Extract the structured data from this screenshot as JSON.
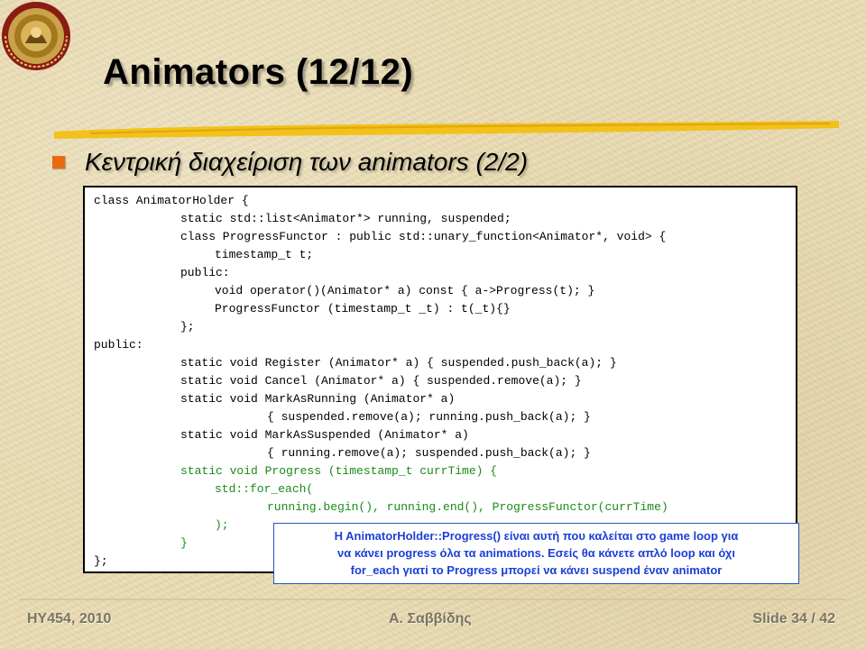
{
  "slide": {
    "title": "Animators (12/12)",
    "subtitle": "Κεντρική διαχείριση των animators (2/2)",
    "logo_text": "UNIVERSITY OF CRETE"
  },
  "code": {
    "lines": [
      {
        "text": "class AnimatorHolder {",
        "indent": 0,
        "color": "black"
      },
      {
        "text": "static std::list<Animator*> running, suspended;",
        "indent": 1,
        "color": "black"
      },
      {
        "text": "class ProgressFunctor : public std::unary_function<Animator*, void> {",
        "indent": 1,
        "color": "black"
      },
      {
        "text": "timestamp_t t;",
        "indent": 2,
        "color": "black"
      },
      {
        "text": "public:",
        "indent": 1,
        "color": "black"
      },
      {
        "text": "void operator()(Animator* a) const { a->Progress(t); }",
        "indent": 2,
        "color": "black"
      },
      {
        "text": "ProgressFunctor (timestamp_t _t) : t(_t){}",
        "indent": 2,
        "color": "black"
      },
      {
        "text": "};",
        "indent": 1,
        "color": "black"
      },
      {
        "text": "public:",
        "indent": 0,
        "color": "black"
      },
      {
        "text": "static void Register (Animator* a) { suspended.push_back(a); }",
        "indent": 1,
        "color": "black"
      },
      {
        "text": "static void Cancel (Animator* a) { suspended.remove(a); }",
        "indent": 1,
        "color": "black"
      },
      {
        "text": "static void MarkAsRunning (Animator* a)",
        "indent": 1,
        "color": "black"
      },
      {
        "text": "{ suspended.remove(a); running.push_back(a); }",
        "indent": 3,
        "color": "black"
      },
      {
        "text": "static void MarkAsSuspended (Animator* a)",
        "indent": 1,
        "color": "black"
      },
      {
        "text": "{ running.remove(a); suspended.push_back(a); }",
        "indent": 3,
        "color": "black"
      },
      {
        "text": "static void Progress (timestamp_t currTime) {",
        "indent": 1,
        "color": "green"
      },
      {
        "text": "std::for_each(",
        "indent": 2,
        "color": "green"
      },
      {
        "text": "running.begin(), running.end(), ProgressFunctor(currTime)",
        "indent": 3,
        "color": "green"
      },
      {
        "text": ");",
        "indent": 2,
        "color": "green"
      },
      {
        "text": "}",
        "indent": 1,
        "color": "green"
      },
      {
        "text": "};",
        "indent": 0,
        "color": "black"
      }
    ]
  },
  "note": {
    "lines": [
      "H AnimatorHolder::Progress() είναι αυτή που καλείται στο game loop για",
      "να κάνει progress όλα τα animations. Εσείς θα κάνετε απλό loop και όχι",
      "for_each γιατί το Progress μπορεί να κάνει suspend έναν animator"
    ]
  },
  "footer": {
    "course": "ΗΥ454, 2010",
    "author": "Α. Σαββίδης",
    "slide_number": "Slide 34 / 42"
  },
  "colors": {
    "bullet": "#e96b10",
    "code_highlight": "#1a8a1a",
    "note_text": "#1c3fd6",
    "title_rule": "#f2c21a"
  }
}
